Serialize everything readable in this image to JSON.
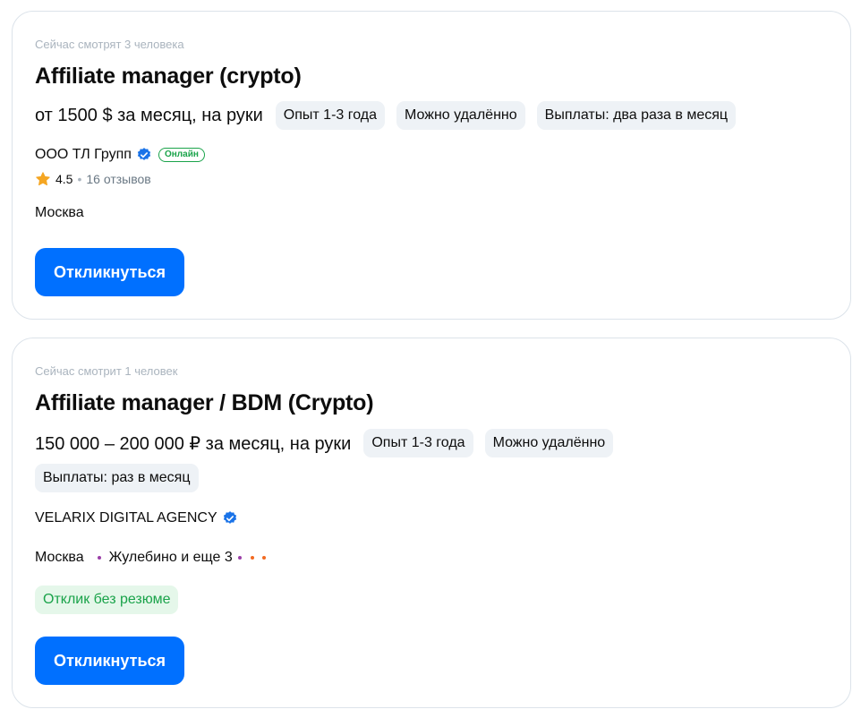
{
  "vacancies": [
    {
      "views": "Сейчас смотрят 3 человека",
      "title": "Affiliate manager (crypto)",
      "salary": "от 1500 $ за месяц, на руки",
      "tags": [
        "Опыт 1-3 года",
        "Можно удалённо",
        "Выплаты: два раза в месяц"
      ],
      "company": "ООО ТЛ Групп",
      "online_badge": "Онлайн",
      "rating": "4.5",
      "reviews": "16 отзывов",
      "city": "Москва",
      "apply_label": "Откликнуться"
    },
    {
      "views": "Сейчас смотрит 1 человек",
      "title": "Affiliate manager / BDM (Crypto)",
      "salary": "150 000 – 200 000 ₽ за месяц, на руки",
      "tags": [
        "Опыт 1-3 года",
        "Можно удалённо",
        "Выплаты: раз в месяц"
      ],
      "company": "VELARIX DIGITAL AGENCY",
      "city": "Москва",
      "metro": "Жулебино и еще 3",
      "no_resume_label": "Отклик без резюме",
      "apply_label": "Откликнуться"
    }
  ],
  "colors": {
    "accent": "#0070ff",
    "verified": "#1a73e8",
    "online": "#1aa34a",
    "star": "#f5a623",
    "metro_line_purple": "#9b3fa8",
    "metro_line_orange": "#f26a21"
  },
  "icons": [
    "verified-badge-icon",
    "star-icon",
    "metro-dot-icon"
  ]
}
